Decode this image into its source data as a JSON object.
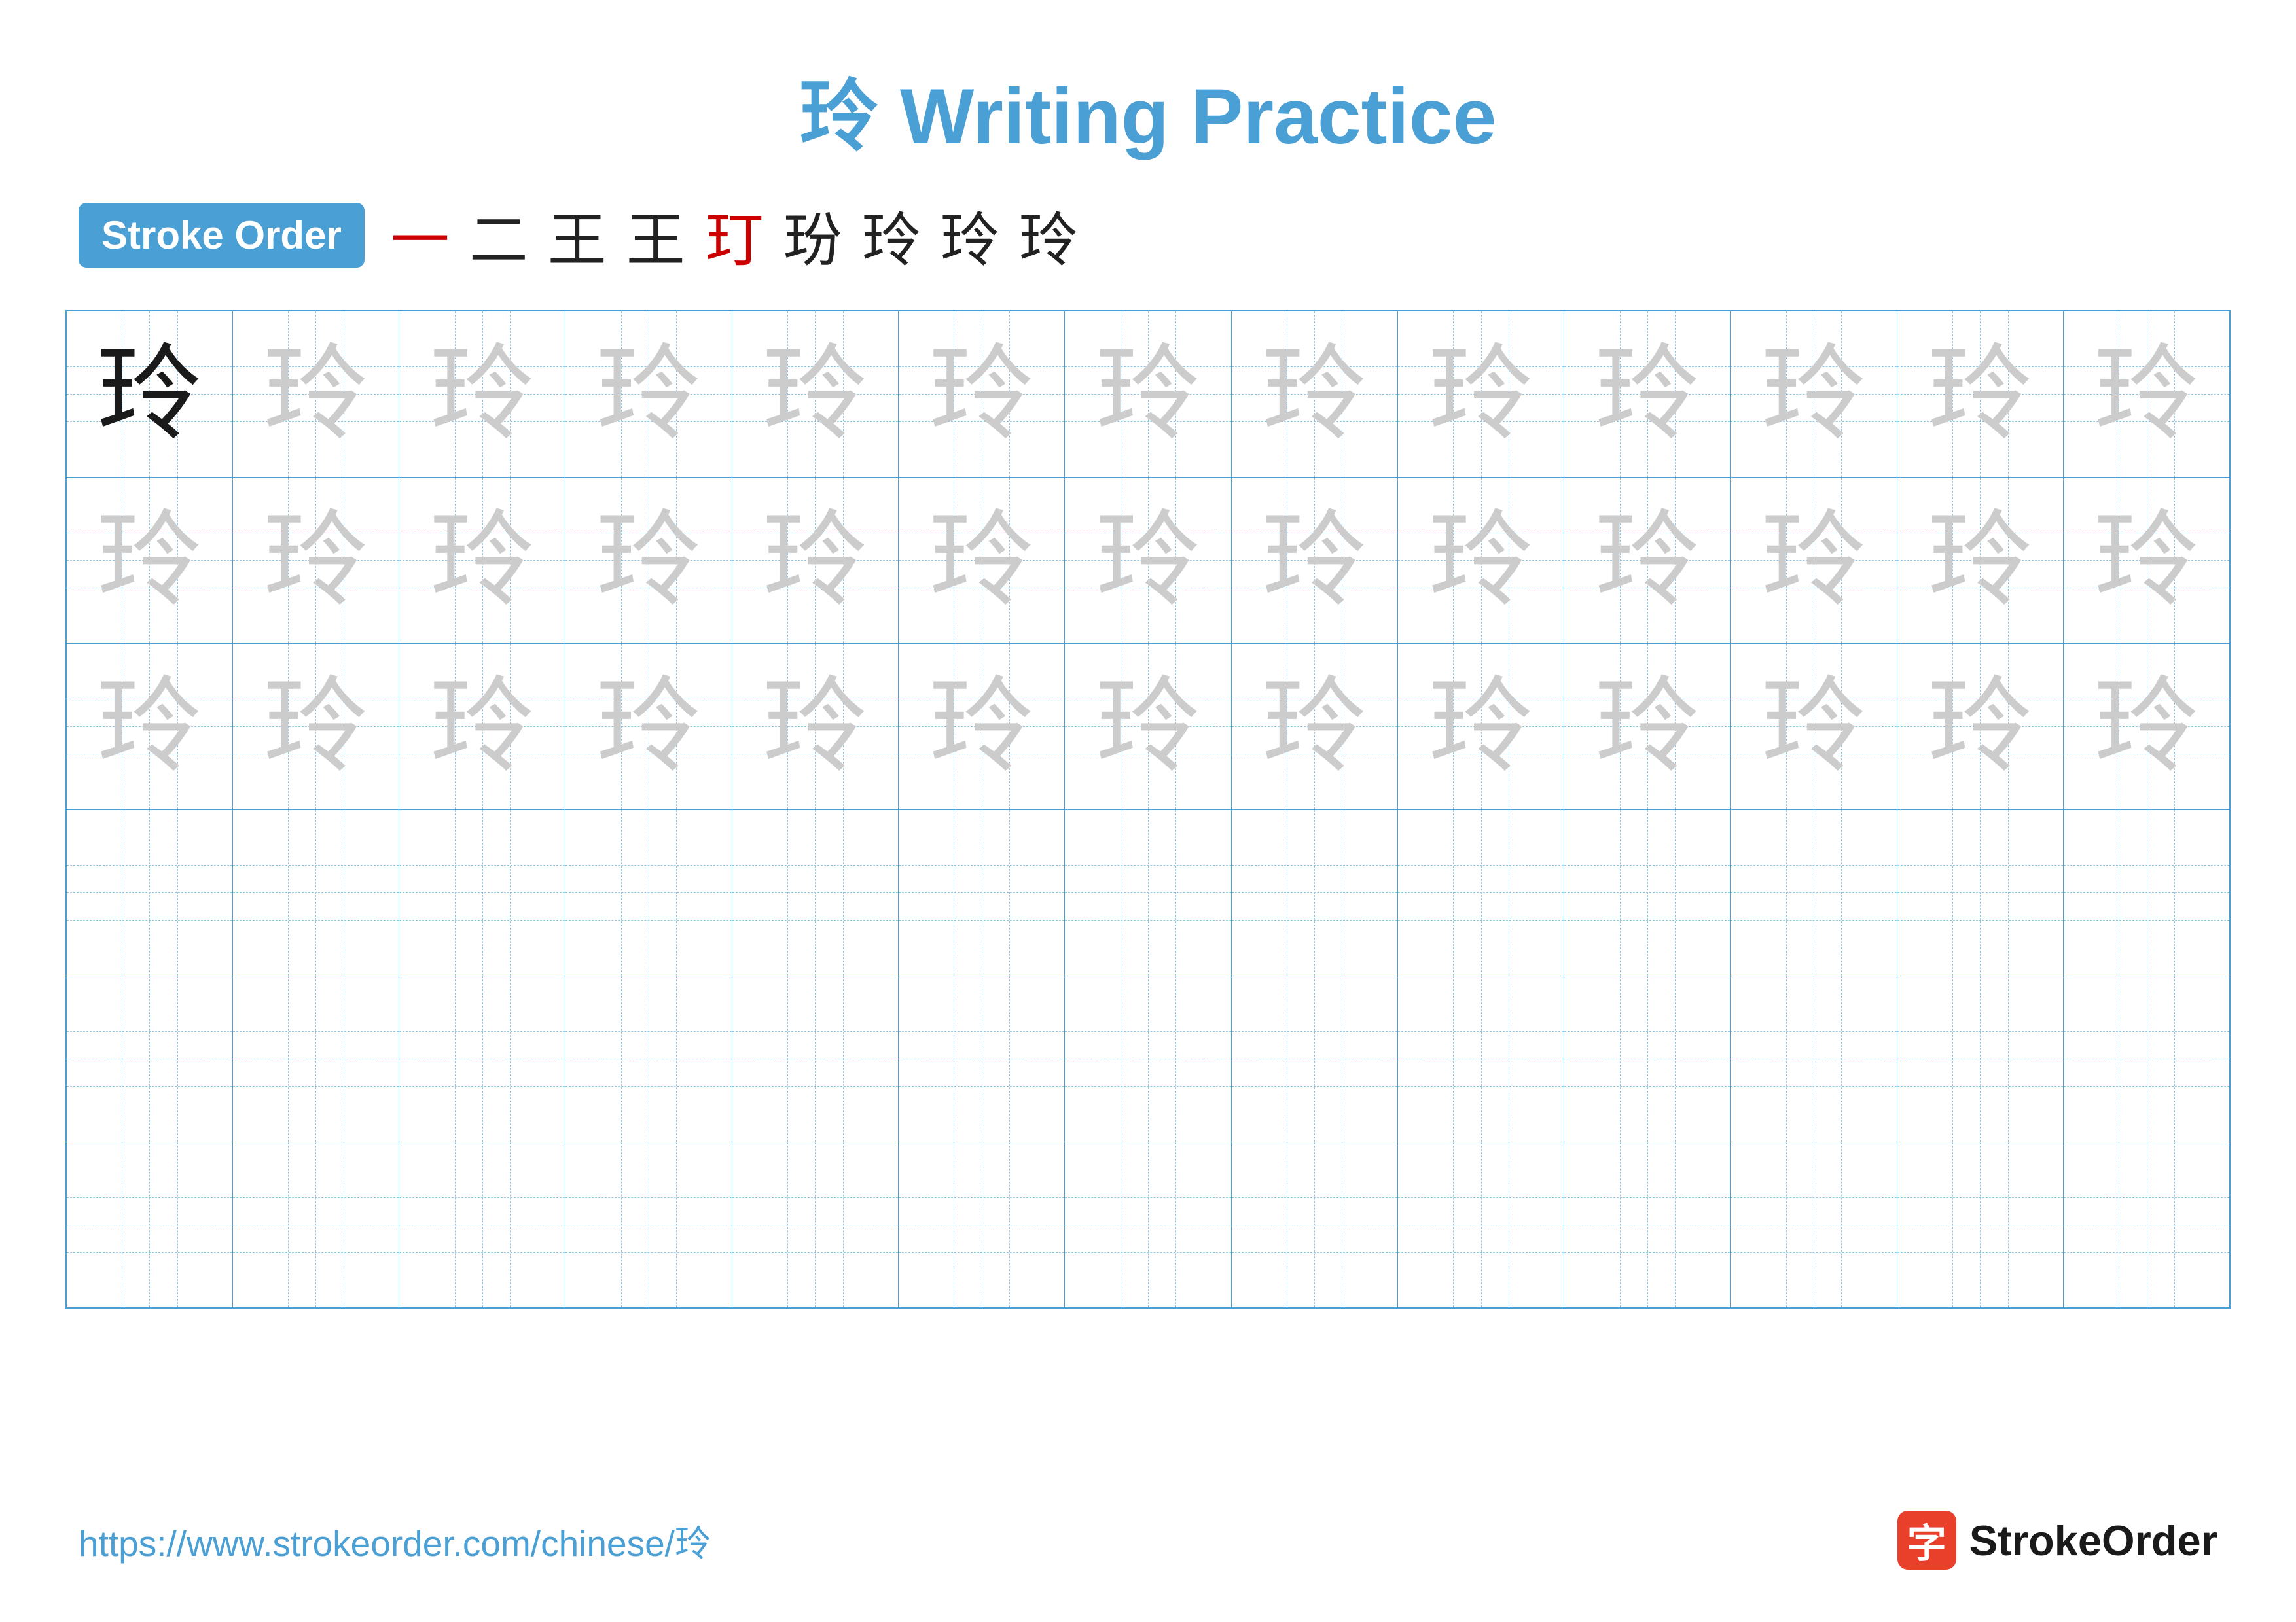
{
  "title": "玲 Writing Practice",
  "character": "玲",
  "stroke_order_label": "Stroke Order",
  "stroke_sequence": [
    "一",
    "二",
    "王",
    "王",
    "玎",
    "玢",
    "玲",
    "玲",
    "玲"
  ],
  "footer": {
    "url": "https://www.strokeorder.com/chinese/玲",
    "logo_text": "StrokeOrder",
    "logo_char": "字"
  },
  "grid": {
    "rows": 6,
    "cols": 13,
    "row_types": [
      "dark",
      "light",
      "light",
      "empty",
      "empty",
      "empty"
    ]
  }
}
